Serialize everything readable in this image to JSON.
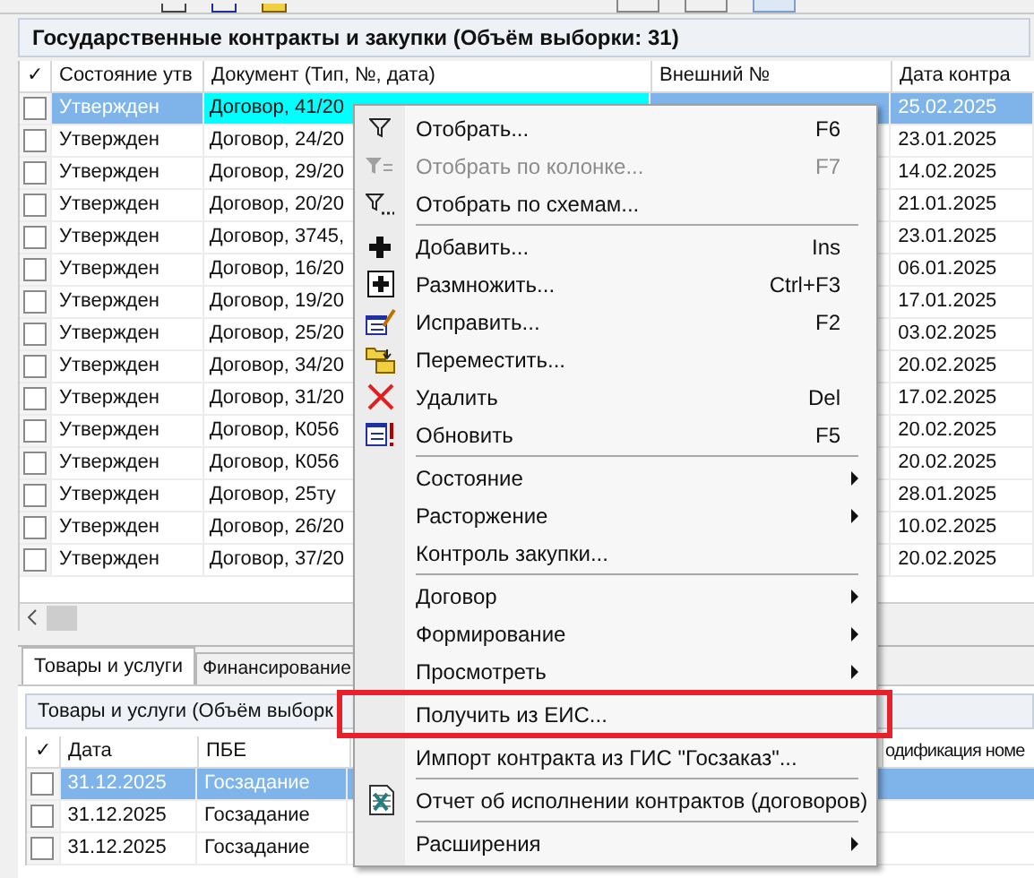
{
  "panel": {
    "title": "Государственные контракты и закупки (Объём выборки: 31)",
    "columns": [
      "✓",
      "Состояние утв",
      "Документ (Тип, №, дата)",
      "Внешний №",
      "Дата контра"
    ],
    "rows": [
      {
        "checked": false,
        "selected": true,
        "state": "Утвержден",
        "document": "Договор, 41/20",
        "date": "25.02.2025"
      },
      {
        "checked": false,
        "selected": false,
        "state": "Утвержден",
        "document": "Договор, 24/20",
        "date": "23.01.2025"
      },
      {
        "checked": false,
        "selected": false,
        "state": "Утвержден",
        "document": "Договор, 29/20",
        "date": "14.02.2025"
      },
      {
        "checked": false,
        "selected": false,
        "state": "Утвержден",
        "document": "Договор, 20/20",
        "date": "21.01.2025"
      },
      {
        "checked": false,
        "selected": false,
        "state": "Утвержден",
        "document": "Договор, 3745,",
        "date": "23.01.2025"
      },
      {
        "checked": false,
        "selected": false,
        "state": "Утвержден",
        "document": "Договор, 16/20",
        "date": "06.01.2025"
      },
      {
        "checked": false,
        "selected": false,
        "state": "Утвержден",
        "document": "Договор, 19/20",
        "date": "17.01.2025"
      },
      {
        "checked": false,
        "selected": false,
        "state": "Утвержден",
        "document": "Договор, 25/20",
        "date": "03.02.2025"
      },
      {
        "checked": false,
        "selected": false,
        "state": "Утвержден",
        "document": "Договор, 34/20",
        "date": "20.02.2025"
      },
      {
        "checked": false,
        "selected": false,
        "state": "Утвержден",
        "document": "Договор, 31/20",
        "date": "17.02.2025"
      },
      {
        "checked": false,
        "selected": false,
        "state": "Утвержден",
        "document": "Договор, К056",
        "date": "20.02.2025"
      },
      {
        "checked": false,
        "selected": false,
        "state": "Утвержден",
        "document": "Договор, К056",
        "date": "20.02.2025"
      },
      {
        "checked": false,
        "selected": false,
        "state": "Утвержден",
        "document": "Договор, 25ту",
        "date": "28.01.2025"
      },
      {
        "checked": false,
        "selected": false,
        "state": "Утвержден",
        "document": "Договор, 26/20",
        "date": "10.02.2025"
      },
      {
        "checked": false,
        "selected": false,
        "state": "Утвержден",
        "document": "Договор, 37/20",
        "date": "20.02.2025"
      }
    ]
  },
  "tabs": [
    {
      "label": "Товары и услуги",
      "selected": true
    },
    {
      "label": "Финансирование",
      "selected": false
    }
  ],
  "goods": {
    "title": "Товары и услуги (Объём выборк",
    "columns": [
      "✓",
      "Дата",
      "ПБЕ",
      "одификация номе"
    ],
    "rows": [
      {
        "checked": false,
        "selected": true,
        "date": "31.12.2025",
        "pbe": "Госзадание"
      },
      {
        "checked": false,
        "selected": false,
        "date": "31.12.2025",
        "pbe": "Госзадание"
      },
      {
        "checked": false,
        "selected": false,
        "date": "31.12.2025",
        "pbe": "Госзадание"
      }
    ]
  },
  "context_menu": [
    {
      "kind": "item",
      "label": "Отобрать...",
      "shortcut": "F6",
      "disabled": false,
      "submenu": false
    },
    {
      "kind": "item",
      "label": "Отобрать по колонке...",
      "shortcut": "F7",
      "disabled": true,
      "submenu": false
    },
    {
      "kind": "item",
      "label": "Отобрать по схемам...",
      "disabled": false,
      "submenu": false
    },
    {
      "kind": "separator"
    },
    {
      "kind": "item",
      "label": "Добавить...",
      "shortcut": "Ins",
      "disabled": false,
      "submenu": false
    },
    {
      "kind": "item",
      "label": "Размножить...",
      "shortcut": "Ctrl+F3",
      "disabled": false,
      "submenu": false
    },
    {
      "kind": "item",
      "label": "Исправить...",
      "shortcut": "F2",
      "disabled": false,
      "submenu": false
    },
    {
      "kind": "item",
      "label": "Переместить...",
      "disabled": false,
      "submenu": false
    },
    {
      "kind": "item",
      "label": "Удалить",
      "shortcut": "Del",
      "disabled": false,
      "submenu": false
    },
    {
      "kind": "item",
      "label": "Обновить",
      "shortcut": "F5",
      "disabled": false,
      "submenu": false
    },
    {
      "kind": "separator"
    },
    {
      "kind": "item",
      "label": "Состояние",
      "disabled": false,
      "submenu": true
    },
    {
      "kind": "item",
      "label": "Расторжение",
      "disabled": false,
      "submenu": true
    },
    {
      "kind": "item",
      "label": "Контроль закупки...",
      "disabled": false,
      "submenu": false
    },
    {
      "kind": "separator"
    },
    {
      "kind": "item",
      "label": "Договор",
      "disabled": false,
      "submenu": true
    },
    {
      "kind": "item",
      "label": "Формирование",
      "disabled": false,
      "submenu": true
    },
    {
      "kind": "item",
      "label": "Просмотреть",
      "disabled": false,
      "submenu": true
    },
    {
      "kind": "separator"
    },
    {
      "kind": "item",
      "label": "Получить из ЕИС...",
      "disabled": false,
      "submenu": false
    },
    {
      "kind": "separator"
    },
    {
      "kind": "item",
      "label": "Импорт контракта из ГИС \"Госзаказ\"...",
      "disabled": false,
      "submenu": false
    },
    {
      "kind": "separator"
    },
    {
      "kind": "item",
      "label": "Отчет об исполнении контрактов (договоров)",
      "disabled": false,
      "submenu": false
    },
    {
      "kind": "separator"
    },
    {
      "kind": "item",
      "label": "Расширения",
      "disabled": false,
      "submenu": true
    }
  ]
}
